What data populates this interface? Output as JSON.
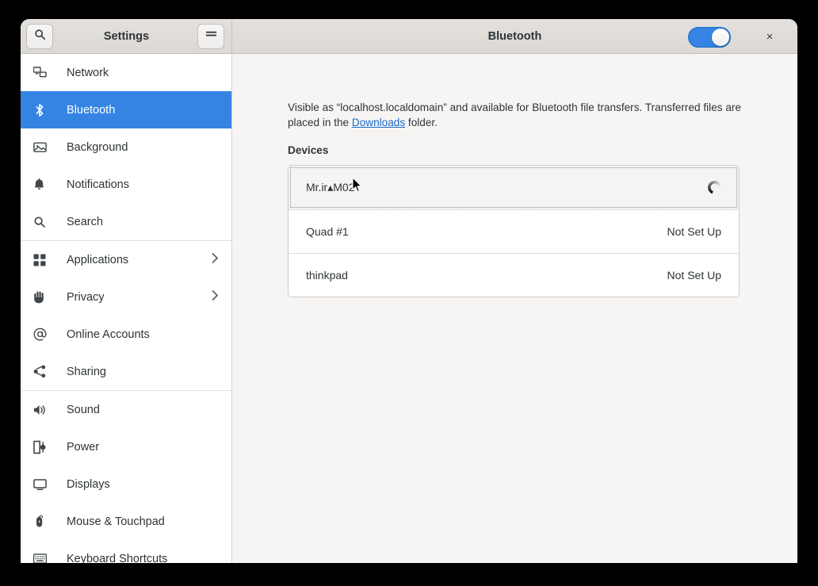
{
  "window": {
    "sidebar_title": "Settings",
    "page_title": "Bluetooth",
    "search_icon": "search-icon",
    "menu_icon": "hamburger-menu-icon",
    "close_label": "×",
    "bluetooth_enabled": true,
    "accent_color": "#3584e4"
  },
  "sidebar": {
    "groups": [
      {
        "items": [
          {
            "label": "Network",
            "icon": "network-icon",
            "selected": false,
            "chevron": false
          },
          {
            "label": "Bluetooth",
            "icon": "bluetooth-icon",
            "selected": true,
            "chevron": false
          },
          {
            "label": "Background",
            "icon": "background-icon",
            "selected": false,
            "chevron": false
          },
          {
            "label": "Notifications",
            "icon": "bell-icon",
            "selected": false,
            "chevron": false
          },
          {
            "label": "Search",
            "icon": "search-icon",
            "selected": false,
            "chevron": false
          }
        ]
      },
      {
        "items": [
          {
            "label": "Applications",
            "icon": "grid-apps-icon",
            "selected": false,
            "chevron": true
          },
          {
            "label": "Privacy",
            "icon": "hand-icon",
            "selected": false,
            "chevron": true
          },
          {
            "label": "Online Accounts",
            "icon": "at-sign-icon",
            "selected": false,
            "chevron": false
          },
          {
            "label": "Sharing",
            "icon": "share-icon",
            "selected": false,
            "chevron": false
          }
        ]
      },
      {
        "items": [
          {
            "label": "Sound",
            "icon": "speaker-icon",
            "selected": false,
            "chevron": false
          },
          {
            "label": "Power",
            "icon": "power-plug-icon",
            "selected": false,
            "chevron": false
          },
          {
            "label": "Displays",
            "icon": "monitor-icon",
            "selected": false,
            "chevron": false
          },
          {
            "label": "Mouse & Touchpad",
            "icon": "mouse-icon",
            "selected": false,
            "chevron": false
          },
          {
            "label": "Keyboard Shortcuts",
            "icon": "keyboard-icon",
            "selected": false,
            "chevron": false
          }
        ]
      }
    ]
  },
  "content": {
    "description_part1": "Visible as “localhost.localdomain” and available for Bluetooth file transfers. Transferred files are placed in the ",
    "description_link": "Downloads",
    "description_part2": " folder.",
    "devices_heading": "Devices",
    "devices": [
      {
        "name": "Mr.ir▴M02",
        "status": "",
        "state": "connecting",
        "focused": true
      },
      {
        "name": "Quad #1",
        "status": "Not Set Up",
        "state": "idle",
        "focused": false
      },
      {
        "name": "thinkpad",
        "status": "Not Set Up",
        "state": "idle",
        "focused": false
      }
    ]
  }
}
